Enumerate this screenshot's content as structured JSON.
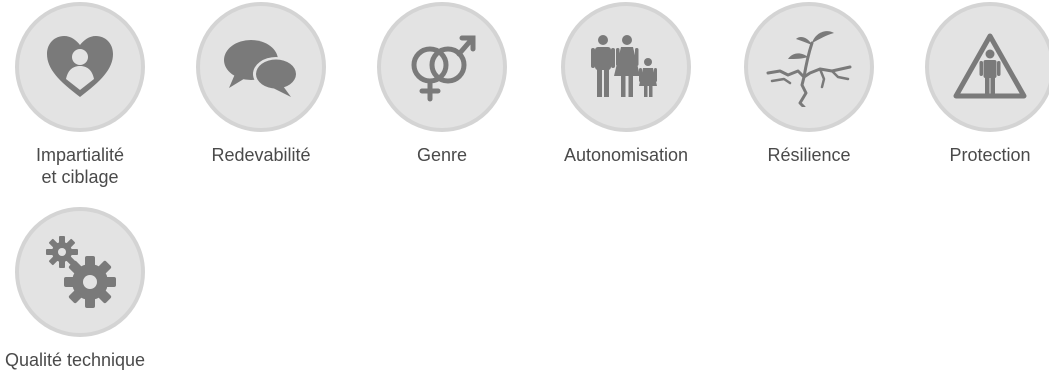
{
  "categories": [
    {
      "label": "Impartialité\net ciblage",
      "icon": "heart-person-icon"
    },
    {
      "label": "Redevabilité",
      "icon": "speech-bubbles-icon"
    },
    {
      "label": "Genre",
      "icon": "gender-symbols-icon"
    },
    {
      "label": "Autonomisation",
      "icon": "family-icon"
    },
    {
      "label": "Résilience",
      "icon": "sprout-crack-icon"
    },
    {
      "label": "Protection",
      "icon": "person-triangle-icon"
    },
    {
      "label": "Qualité technique",
      "icon": "gears-icon"
    }
  ],
  "colors": {
    "icon": "#7a7a7a",
    "circle_fill": "#e3e3e3",
    "circle_border": "#d4d4d4",
    "label": "#4a4a4a"
  }
}
